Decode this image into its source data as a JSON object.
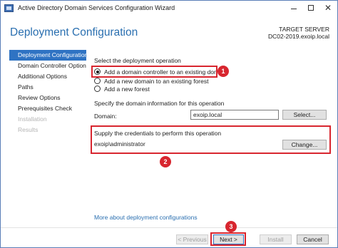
{
  "window": {
    "title": "Active Directory Domain Services Configuration Wizard",
    "minimize_glyph": "",
    "maximize_glyph": "",
    "close_glyph": "✕"
  },
  "header": {
    "page_title": "Deployment Configuration",
    "target_label": "TARGET SERVER",
    "target_server": "DC02-2019.exoip.local"
  },
  "sidebar": {
    "items": [
      {
        "label": "Deployment Configuration",
        "state": "active"
      },
      {
        "label": "Domain Controller Options",
        "state": "normal"
      },
      {
        "label": "Additional Options",
        "state": "normal"
      },
      {
        "label": "Paths",
        "state": "normal"
      },
      {
        "label": "Review Options",
        "state": "normal"
      },
      {
        "label": "Prerequisites Check",
        "state": "normal"
      },
      {
        "label": "Installation",
        "state": "disabled"
      },
      {
        "label": "Results",
        "state": "disabled"
      }
    ]
  },
  "main": {
    "operation_heading": "Select the deployment operation",
    "operations": [
      {
        "label": "Add a domain controller to an existing domain",
        "checked": true
      },
      {
        "label": "Add a new domain to an existing forest",
        "checked": false
      },
      {
        "label": "Add a new forest",
        "checked": false
      }
    ],
    "domain_heading": "Specify the domain information for this operation",
    "domain_label": "Domain:",
    "domain_value": "exoip.local",
    "select_button": "Select...",
    "credentials_heading": "Supply the credentials to perform this operation",
    "credentials_value": "exoip\\administrator",
    "change_button": "Change...",
    "more_link": "More about deployment configurations"
  },
  "callouts": {
    "one": "1",
    "two": "2",
    "three": "3"
  },
  "footer": {
    "previous_button": "< Previous",
    "next_button": "Next >",
    "install_button": "Install",
    "cancel_button": "Cancel"
  },
  "colors": {
    "accent_blue": "#2f73c3",
    "title_blue": "#2a6fb0",
    "annotation_red": "#d8262f"
  }
}
